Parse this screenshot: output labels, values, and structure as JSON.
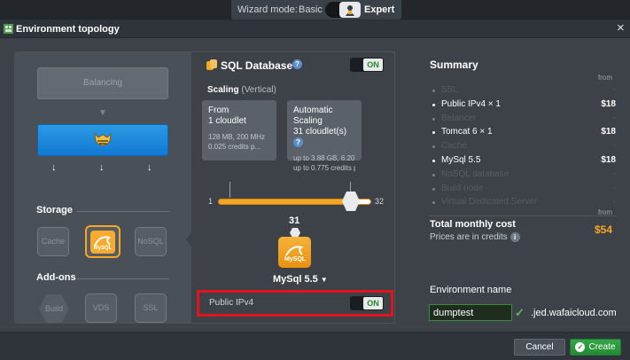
{
  "wizard": {
    "label": "Wizard mode:",
    "mode_basic": "Basic",
    "mode_expert": "Expert"
  },
  "dialog": {
    "title": "Environment topology",
    "close": "×"
  },
  "topology": {
    "balancing": "Balancing",
    "storage_label": "Storage",
    "storage": [
      "Cache",
      "NoSQL"
    ],
    "addons_label": "Add-ons",
    "addons": [
      "Build",
      "VDS",
      "SSL"
    ]
  },
  "node": {
    "title": "SQL Database",
    "toggle": "ON",
    "scaling_label": "Scaling",
    "scaling_type": "(Vertical)",
    "fixed": {
      "title": "From",
      "value": "1 cloudlet",
      "detail1": "128 MB, 200 MHz",
      "detail2": "0.025 credits p..."
    },
    "auto": {
      "title": "Automatic Scaling",
      "value": "31 cloudlet(s)",
      "detail1": "up to 3.88 GB, 6.20 GHz",
      "detail2": "up to 0.775 credits per..."
    },
    "slider": {
      "min": "1",
      "max": "32",
      "value": 31
    },
    "count": "31",
    "name": "MySql 5.5",
    "public_ipv4_label": "Public IPv4",
    "public_ipv4_toggle": "ON"
  },
  "summary": {
    "title": "Summary",
    "from": "from",
    "rows": [
      {
        "label": "SSL",
        "active": false,
        "price": ""
      },
      {
        "label": "Public IPv4 × 1",
        "active": true,
        "price": "$18"
      },
      {
        "label": "Balancer",
        "active": false,
        "price": ""
      },
      {
        "label": "Tomcat 6 × 1",
        "active": true,
        "price": "$18"
      },
      {
        "label": "Cache",
        "active": false,
        "price": ""
      },
      {
        "label": "MySql 5.5",
        "active": true,
        "price": "$18"
      },
      {
        "label": "NoSQL database",
        "active": false,
        "price": ""
      },
      {
        "label": "Build node",
        "active": false,
        "price": ""
      },
      {
        "label": "Virtual Dedicated Server",
        "active": false,
        "price": ""
      }
    ],
    "total_from": "from",
    "total_label": "Total monthly cost",
    "total_sub": "Prices are in credits",
    "total_value": "$54"
  },
  "environment": {
    "label": "Environment name",
    "value": "dumptest",
    "domain": ".jed.wafaicloud.com"
  },
  "buttons": {
    "cancel": "Cancel",
    "create": "Create"
  },
  "colors": {
    "accent": "#f5a623",
    "primary_blue": "#1c8ad9",
    "create_green": "#2e9a3f",
    "highlight_red": "#e3131b"
  }
}
